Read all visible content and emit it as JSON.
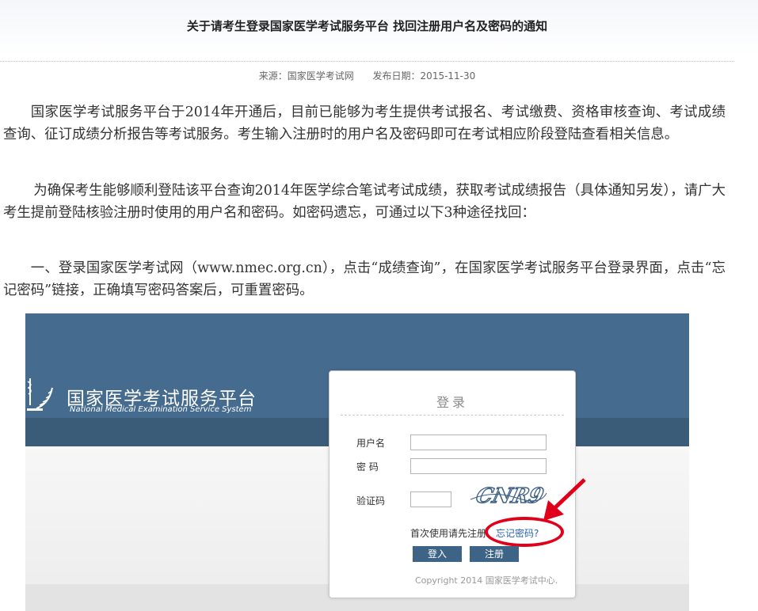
{
  "article": {
    "title": "关于请考生登录国家医学考试服务平台 找回注册用户名及密码的通知",
    "source": "来源：国家医学考试网",
    "date": "发布日期：2015-11-30",
    "paragraphs": [
      "国家医学考试服务平台于2014年开通后，目前已能够为考生提供考试报名、考试缴费、资格审核查询、考试成绩查询、征订成绩分析报告等考试服务。考生输入注册时的用户名及密码即可在考试相应阶段登陆查看相关信息。",
      "为确保考生能够顺利登陆该平台查询2014年医学综合笔试考试成绩，获取考试成绩报告（具体通知另发），请广大考生提前登陆核验注册时使用的用户名和密码。如密码遗忘，可通过以下3种途径找回：",
      "一、登录国家医学考试网（www.nmec.org.cn），点击“成绩查询”，在国家医学考试服务平台登录界面，点击“忘记密码”链接，正确填写密码答案后，可重置密码。"
    ]
  },
  "screenshot": {
    "brand_cn": "国家医学考试服务平台",
    "brand_en": "National Medical Examination Service System",
    "login": {
      "title": "登录",
      "username_label": "用户名",
      "password_label": "密 码",
      "captcha_label": "验证码",
      "captcha_text": "CNR9",
      "first_use_text": "首次使用请先注册",
      "forgot_link": "忘记密码?",
      "login_button": "登入",
      "register_button": "注册",
      "copyright": "Copyright 2014 国家医学考试中心."
    },
    "colors": {
      "header": "#456c8e",
      "strip": "#3b5c79",
      "highlight": "#e0001a",
      "link": "#2a62b1"
    }
  }
}
